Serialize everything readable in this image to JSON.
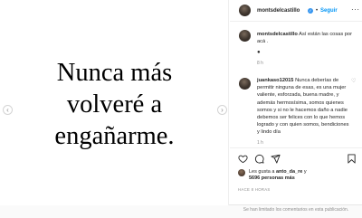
{
  "media": {
    "lines": [
      "Nunca más",
      "volveré a",
      "engañarme."
    ],
    "prev_arrow": "‹",
    "next_arrow": "›"
  },
  "header": {
    "username": "montsdelcastillo",
    "verified_icon": "✓",
    "separator": "•",
    "follow_label": "Seguir",
    "more_icon": "···"
  },
  "caption": {
    "username": "montsdelcastillo",
    "text": "Así están las cosas por acá .",
    "emoji": "●",
    "time": "8 h"
  },
  "reply": {
    "username": "juankaso12015",
    "text": "Nunca deberías de permitir ninguna de esas, es una mujer valiente, esforzada, buena madre, y además hermosísima, somos quienes somos y si no le hacemos daño a nadie debemos ser felices con lo que hemos logrado y con quien somos, bendiciones y lindo día",
    "time": "1 h",
    "heart_icon": "♡"
  },
  "actions": {
    "like_icon": "heart-icon",
    "comment_icon": "comment-icon",
    "share_icon": "share-icon",
    "save_icon": "bookmark-icon"
  },
  "likes": {
    "prefix": "Les gusta a ",
    "user": "anto_da_re",
    "connector": " y",
    "count": "5696 personas más"
  },
  "post_time": "HACE 8 HORAS",
  "disabled_note": "Se han limitado los comentarios en esta publicación.",
  "colors": {
    "accent": "#0095f6",
    "verified": "#3897f0",
    "muted": "#8e8e8e",
    "text": "#262626"
  }
}
